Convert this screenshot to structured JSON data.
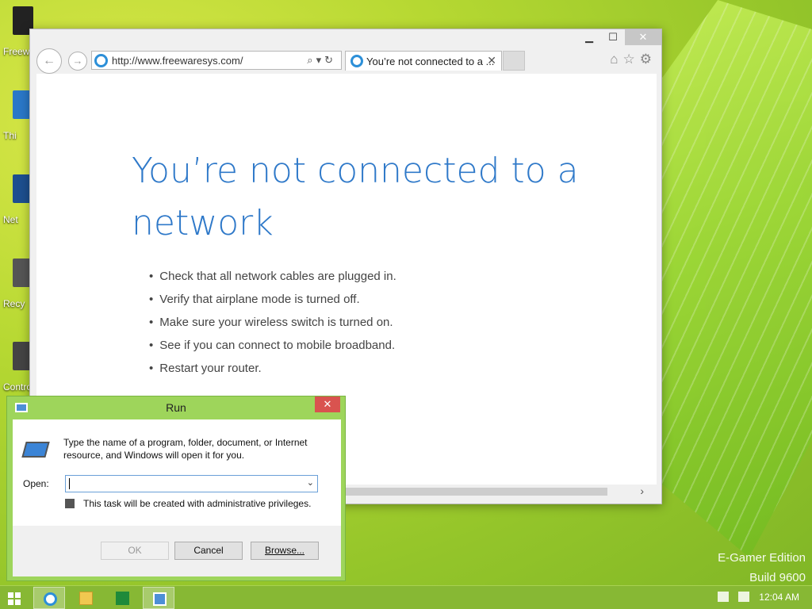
{
  "desktop": {
    "icons": [
      {
        "label": "Freew"
      },
      {
        "label": "Thi"
      },
      {
        "label": "Net"
      },
      {
        "label": "Recy"
      },
      {
        "label": "Contro"
      }
    ],
    "watermark": {
      "line1": "E-Gamer Edition",
      "line2": "Build 9600"
    }
  },
  "browser": {
    "address": "http://www.freewaresys.com/",
    "tab_title": "You’re not connected to a ...",
    "error_title": "You’re not connected to a network",
    "suggestions": [
      "Check that all network cables are plugged in.",
      "Verify that airplane mode is turned off.",
      "Make sure your wireless switch is turned on.",
      "See if you can connect to mobile broadband.",
      "Restart your router."
    ]
  },
  "run_dialog": {
    "title": "Run",
    "description": "Type the name of a program, folder, document, or Internet resource, and Windows will open it for you.",
    "open_label": "Open:",
    "open_value": "",
    "admin_note": "This task will be created with administrative privileges.",
    "ok_label": "OK",
    "cancel_label": "Cancel",
    "browse_label": "Browse..."
  },
  "taskbar": {
    "clock": "12:04 AM",
    "accent": "#87b834"
  }
}
